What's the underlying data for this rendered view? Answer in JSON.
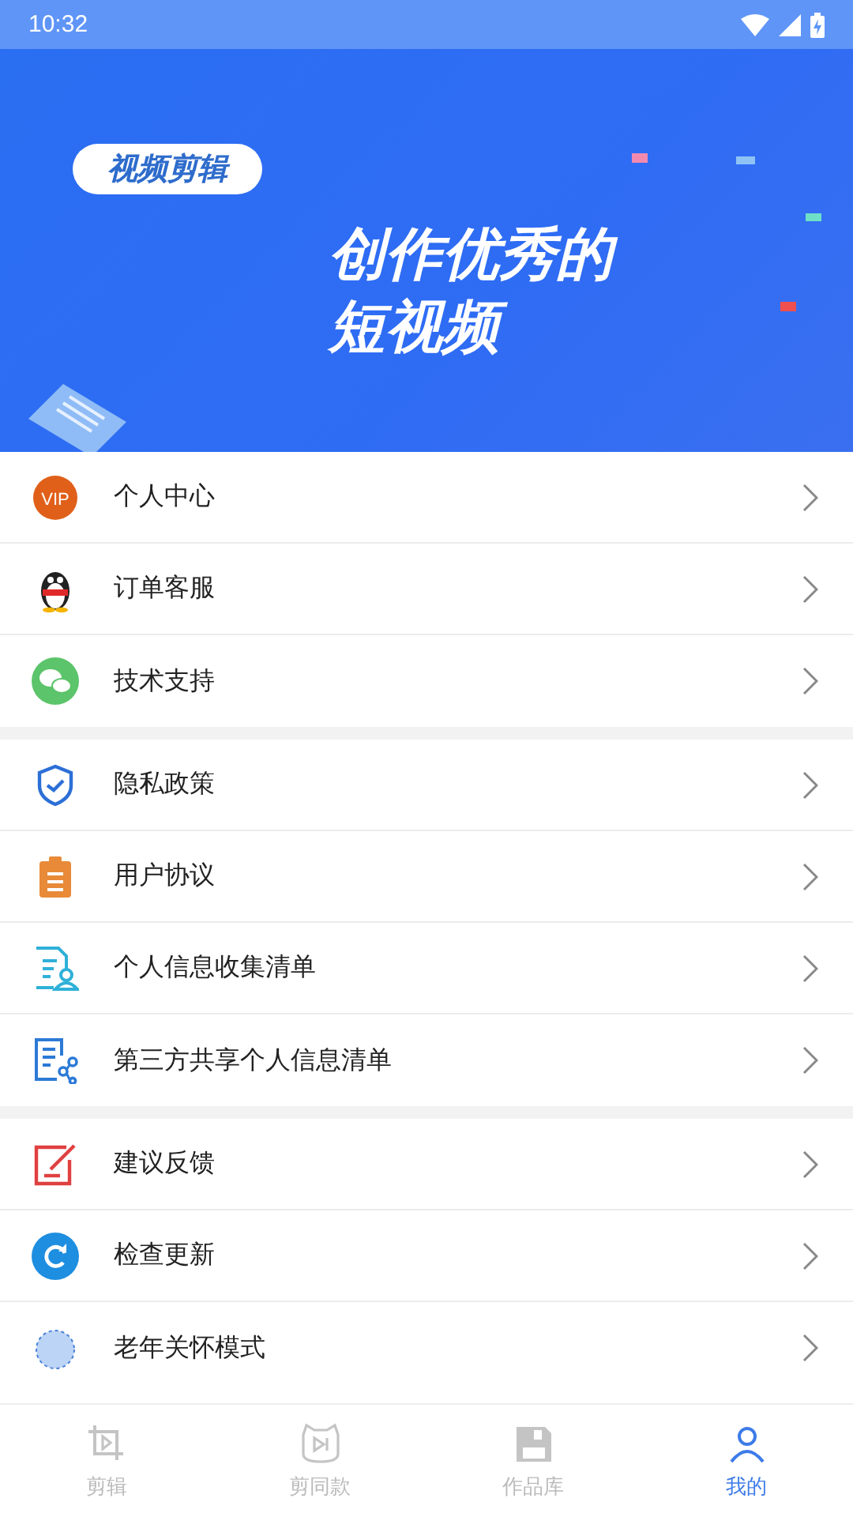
{
  "status_bar": {
    "time": "10:32"
  },
  "banner": {
    "tag": "视频剪辑",
    "headline": [
      "创作优秀的",
      "短视频"
    ]
  },
  "menu_groups": [
    {
      "items": [
        {
          "label": "个人中心",
          "badge": "VIP"
        },
        {
          "label": "订单客服"
        },
        {
          "label": "技术支持"
        }
      ]
    },
    {
      "items": [
        {
          "label": "隐私政策"
        },
        {
          "label": "用户协议"
        },
        {
          "label": "个人信息收集清单"
        },
        {
          "label": "第三方共享个人信息清单"
        }
      ]
    },
    {
      "items": [
        {
          "label": "建议反馈"
        },
        {
          "label": "检查更新"
        },
        {
          "label": "老年关怀模式"
        }
      ]
    }
  ],
  "tab_bar": [
    {
      "label": "剪辑",
      "selected": false
    },
    {
      "label": "剪同款",
      "selected": false
    },
    {
      "label": "作品库",
      "selected": false
    },
    {
      "label": "我的",
      "selected": true
    }
  ]
}
